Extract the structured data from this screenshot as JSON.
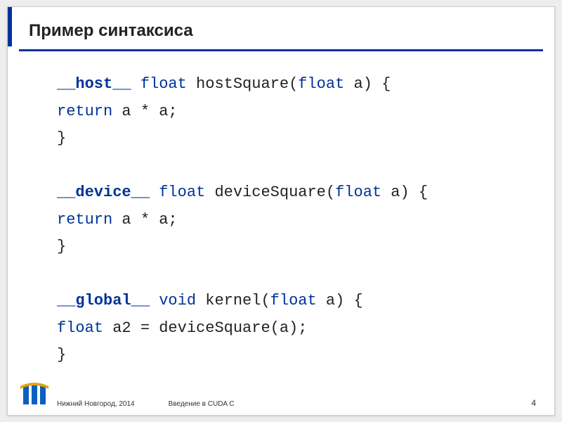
{
  "title": "Пример синтаксиса",
  "code": {
    "l1": {
      "qual": "__host__",
      "type": "float",
      "fn": " hostSquare(",
      "param_type": "float",
      "rest": " a) {"
    },
    "l2": {
      "indent": "    ",
      "kw": "return",
      "rest": " a * a;"
    },
    "l3": "}",
    "l4": {
      "qual": "__device__",
      "type": "float",
      "fn": " deviceSquare(",
      "param_type": "float",
      "rest": " a) {"
    },
    "l5": {
      "indent": "    ",
      "kw": "return",
      "rest": " a * a;"
    },
    "l6": "}",
    "l7": {
      "qual": "__global__",
      "type": "void",
      "fn": " kernel(",
      "param_type": "float",
      "rest": " a) {"
    },
    "l8": {
      "indent": "    ",
      "type": "float",
      "rest": " a2 = deviceSquare(a);"
    },
    "l9": "}"
  },
  "footer": {
    "location": "Нижний Новгород, 2014",
    "course": "Введение в CUDA C",
    "page": "4"
  }
}
